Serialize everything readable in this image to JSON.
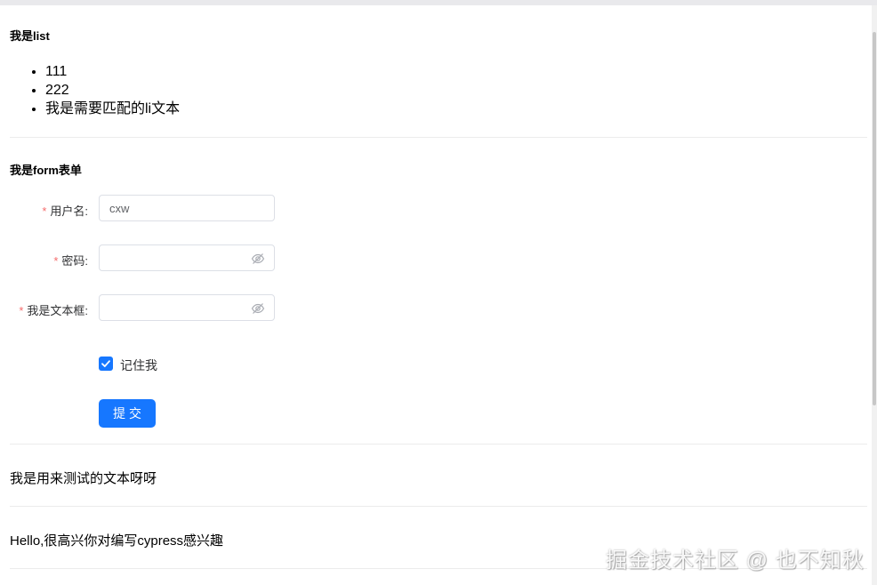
{
  "list_section": {
    "title": "我是list",
    "items": [
      "111",
      "222",
      "我是需要匹配的li文本"
    ]
  },
  "form_section": {
    "title": "我是form表单",
    "username": {
      "label": "用户名:",
      "value": "cxw"
    },
    "password": {
      "label": "密码:",
      "value": ""
    },
    "textbox": {
      "label": "我是文本框:",
      "value": ""
    },
    "remember": {
      "label": "记住我",
      "checked": true
    },
    "submit_label": "提交",
    "required_mark": "*"
  },
  "test_text": "我是用来测试的文本呀呀",
  "hello_text": "Hello,很高兴你对编写cypress感兴趣",
  "watermark": "掘金技术社区 @ 也不知秋",
  "colors": {
    "primary": "#1677ff",
    "required": "#f56c6c",
    "border": "#dcdfe6"
  },
  "icons": {
    "password_toggle": "eye-invisible-icon",
    "checkbox": "check-icon"
  }
}
